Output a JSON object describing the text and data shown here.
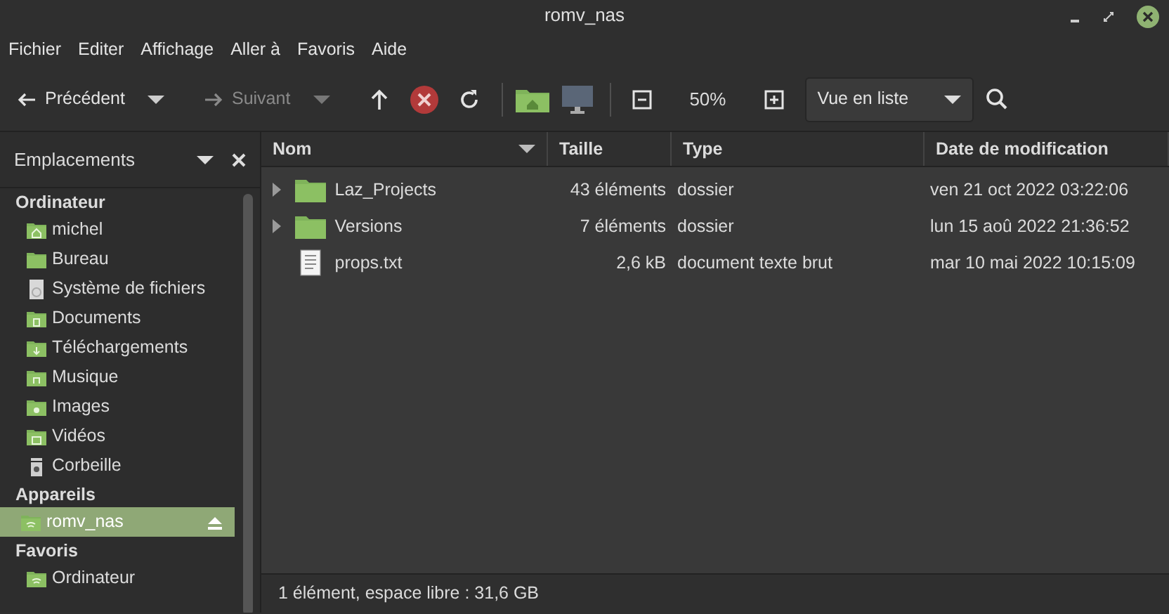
{
  "window": {
    "title": "romv_nas"
  },
  "menu": [
    "Fichier",
    "Editer",
    "Affichage",
    "Aller à",
    "Favoris",
    "Aide"
  ],
  "toolbar": {
    "back": {
      "label": "Précédent",
      "disabled": false
    },
    "forward": {
      "label": "Suivant",
      "disabled": true
    },
    "zoom": "50%",
    "view": "Vue en liste"
  },
  "sidebar": {
    "title": "Emplacements",
    "sections": [
      {
        "title": "Ordinateur",
        "items": [
          {
            "label": "michel",
            "kind": "home",
            "selected": false
          },
          {
            "label": "Bureau",
            "kind": "folder",
            "selected": false
          },
          {
            "label": "Système de fichiers",
            "kind": "drive",
            "selected": false
          },
          {
            "label": "Documents",
            "kind": "documents",
            "selected": false
          },
          {
            "label": "Téléchargements",
            "kind": "download",
            "selected": false
          },
          {
            "label": "Musique",
            "kind": "music",
            "selected": false
          },
          {
            "label": "Images",
            "kind": "images",
            "selected": false
          },
          {
            "label": "Vidéos",
            "kind": "videos",
            "selected": false
          },
          {
            "label": "Corbeille",
            "kind": "trash",
            "selected": false
          }
        ]
      },
      {
        "title": "Appareils",
        "items": [
          {
            "label": "romv_nas",
            "kind": "network",
            "selected": true,
            "eject": true
          }
        ]
      },
      {
        "title": "Favoris",
        "items": [
          {
            "label": "Ordinateur",
            "kind": "network",
            "selected": false
          }
        ]
      }
    ]
  },
  "table": {
    "columns": [
      {
        "label": "Nom",
        "sorted": true
      },
      {
        "label": "Taille",
        "sorted": false
      },
      {
        "label": "Type",
        "sorted": false
      },
      {
        "label": "Date de modification",
        "sorted": false
      }
    ],
    "rows": [
      {
        "kind": "folder",
        "expandable": true,
        "name": "Laz_Projects",
        "size": "43 éléments",
        "type": "dossier",
        "modified": "ven 21 oct 2022 03:22:06"
      },
      {
        "kind": "folder",
        "expandable": true,
        "name": "Versions",
        "size": "7 éléments",
        "type": "dossier",
        "modified": "lun 15 aoû 2022 21:36:52"
      },
      {
        "kind": "file",
        "expandable": false,
        "name": "props.txt",
        "size": "2,6 kB",
        "type": "document texte brut",
        "modified": "mar 10 mai 2022 10:15:09"
      }
    ]
  },
  "status_bar": "1 élément, espace libre : 31,6 GB"
}
